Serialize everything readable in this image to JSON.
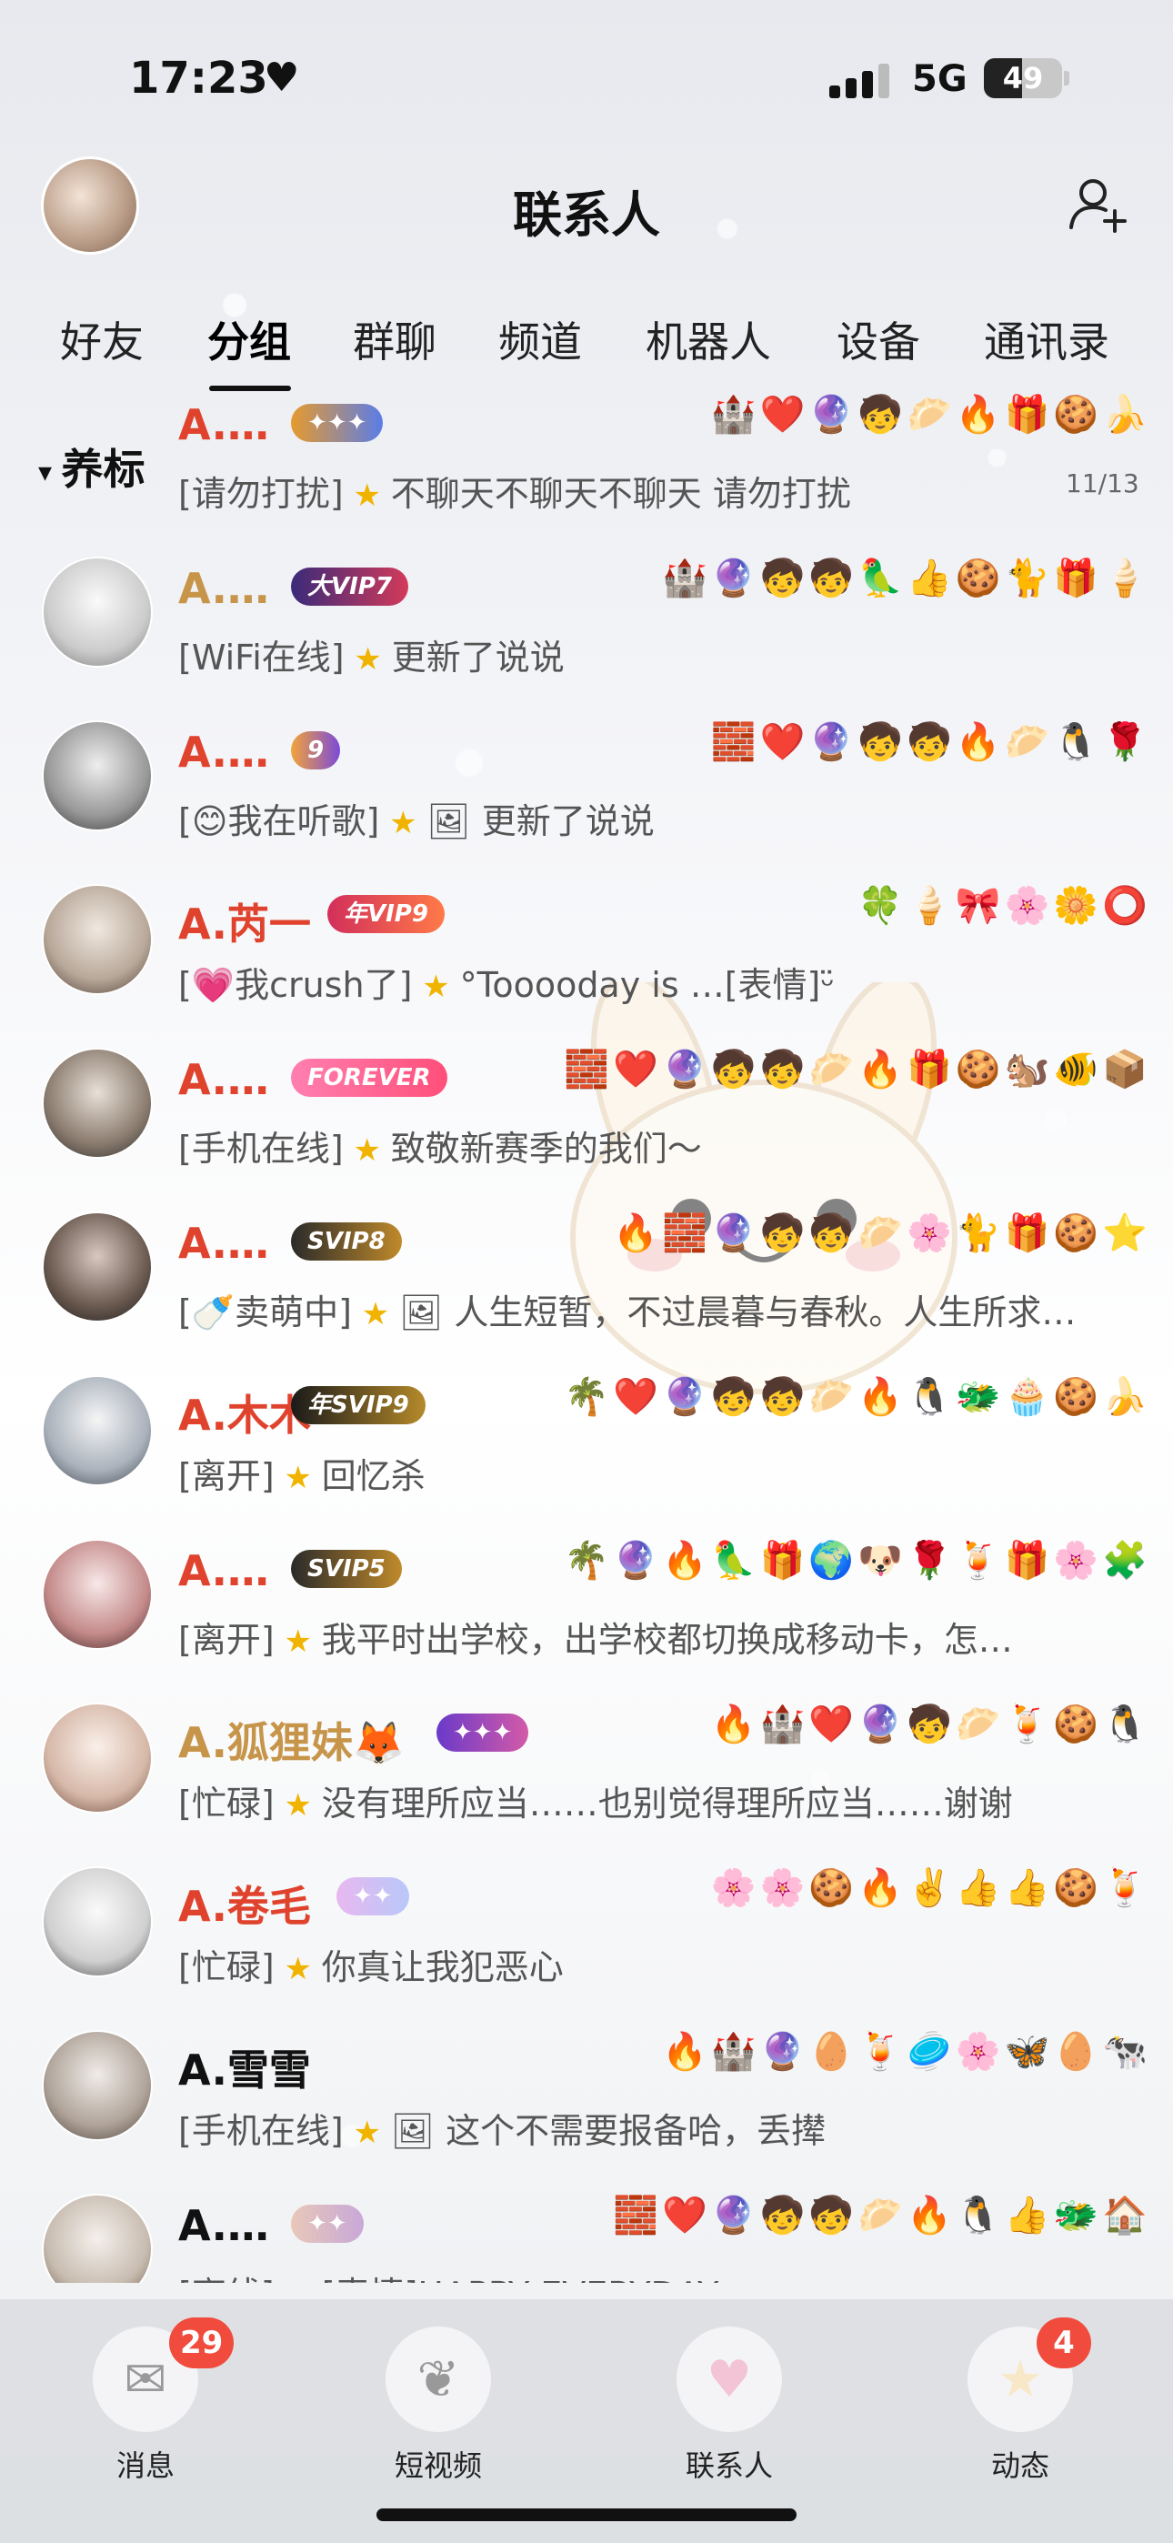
{
  "status_bar": {
    "time": "17:23",
    "network": "5G",
    "battery": "49"
  },
  "header": {
    "title": "联系人"
  },
  "tabs": [
    "好友",
    "分组",
    "群聊",
    "频道",
    "机器人",
    "设备",
    "通讯录"
  ],
  "active_tab": "分组",
  "group": {
    "name": "养标",
    "count": "11/13"
  },
  "contacts": [
    {
      "name": "A.…",
      "status_prefix": "[请勿打扰]",
      "status_text": "不聊天不聊天不聊天 请勿打扰",
      "vip": "",
      "emojis": "🏰❤️🔮🧒🥟🔥🎁🍪🍌"
    },
    {
      "name": "A.…",
      "status_prefix": "[WiFi在线]",
      "status_text": "更新了说说",
      "vip": "大VIP7",
      "emojis": "🏰🔮🧒🧒🦜👍🍪🐈🎁🍦"
    },
    {
      "name": "A.…",
      "status_prefix": "[😊我在听歌]",
      "status_text": "🖼 更新了说说",
      "vip": "9",
      "emojis": "🧱❤️🔮🧒🧒🔥🥟🐧🌹"
    },
    {
      "name": "A.芮一",
      "status_prefix": "[💗我crush了]",
      "status_text": "°Tooooday is …[表情]ᵕ̈ ",
      "vip": "年VIP9",
      "emojis": "🍀🍦🎀🌸🌼⭕"
    },
    {
      "name": "A.…",
      "status_prefix": "[手机在线]",
      "status_text": "致敬新赛季的我们～",
      "vip": "FOREVER",
      "emojis": "🧱❤️🔮🧒🧒🥟🔥🎁🍪🐿️🐠📦"
    },
    {
      "name": "A.…",
      "status_prefix": "[🍼卖萌中]",
      "status_text": "🖼 人生短暂，不过晨暮与春秋。人生所求…",
      "vip": "SVIP8",
      "emojis": "🔥🧱🔮🧒🧒🥟🌸🐈🎁🍪⭐"
    },
    {
      "name": "A.木木",
      "status_prefix": "[离开]",
      "status_text": "回忆杀",
      "vip": "年SVIP9",
      "emojis": "🌴❤️🔮🧒🧒🥟🔥🐧🐲🧁🍪🍌"
    },
    {
      "name": "A.…",
      "status_prefix": "[离开]",
      "status_text": "我平时出学校，出学校都切换成移动卡，怎…",
      "vip": "SVIP5",
      "emojis": "🌴🔮🔥🦜🎁🌍🐶🌹🍹🎁🌸🧩"
    },
    {
      "name": "A.狐狸妹🦊",
      "status_prefix": "[忙碌]",
      "status_text": "没有理所应当……也别觉得理所应当……谢谢",
      "vip": "",
      "emojis": "🔥🏰❤️🔮🧒🥟🍹🍪🐧"
    },
    {
      "name": "A.卷毛",
      "status_prefix": "[忙碌]",
      "status_text": "你真让我犯恶心",
      "vip": "",
      "emojis": "🌸🌸🍪🔥✌️👍👍🍪🍹"
    },
    {
      "name": "A.雪雪",
      "status_prefix": "[手机在线]",
      "status_text": "🖼 这个不需要报备哈，丢撵",
      "vip": "",
      "emojis": "🔥🏰🔮🥚🍹🥏🌸🦋🥚🐄"
    },
    {
      "name": "A.…",
      "status_prefix": "[离线]",
      "status_text": "[表情]HAPPY EVERYDAY",
      "vip": "",
      "emojis": "🧱❤️🔮🧒🧒🥟🔥🐧👍🐲🏠"
    }
  ],
  "tabbar": [
    {
      "label": "消息",
      "badge": "29",
      "icon": "mail-icon"
    },
    {
      "label": "短视频",
      "badge": "",
      "icon": "leaf-icon"
    },
    {
      "label": "联系人",
      "badge": "",
      "icon": "heart-icon"
    },
    {
      "label": "动态",
      "badge": "4",
      "icon": "star-icon"
    }
  ]
}
